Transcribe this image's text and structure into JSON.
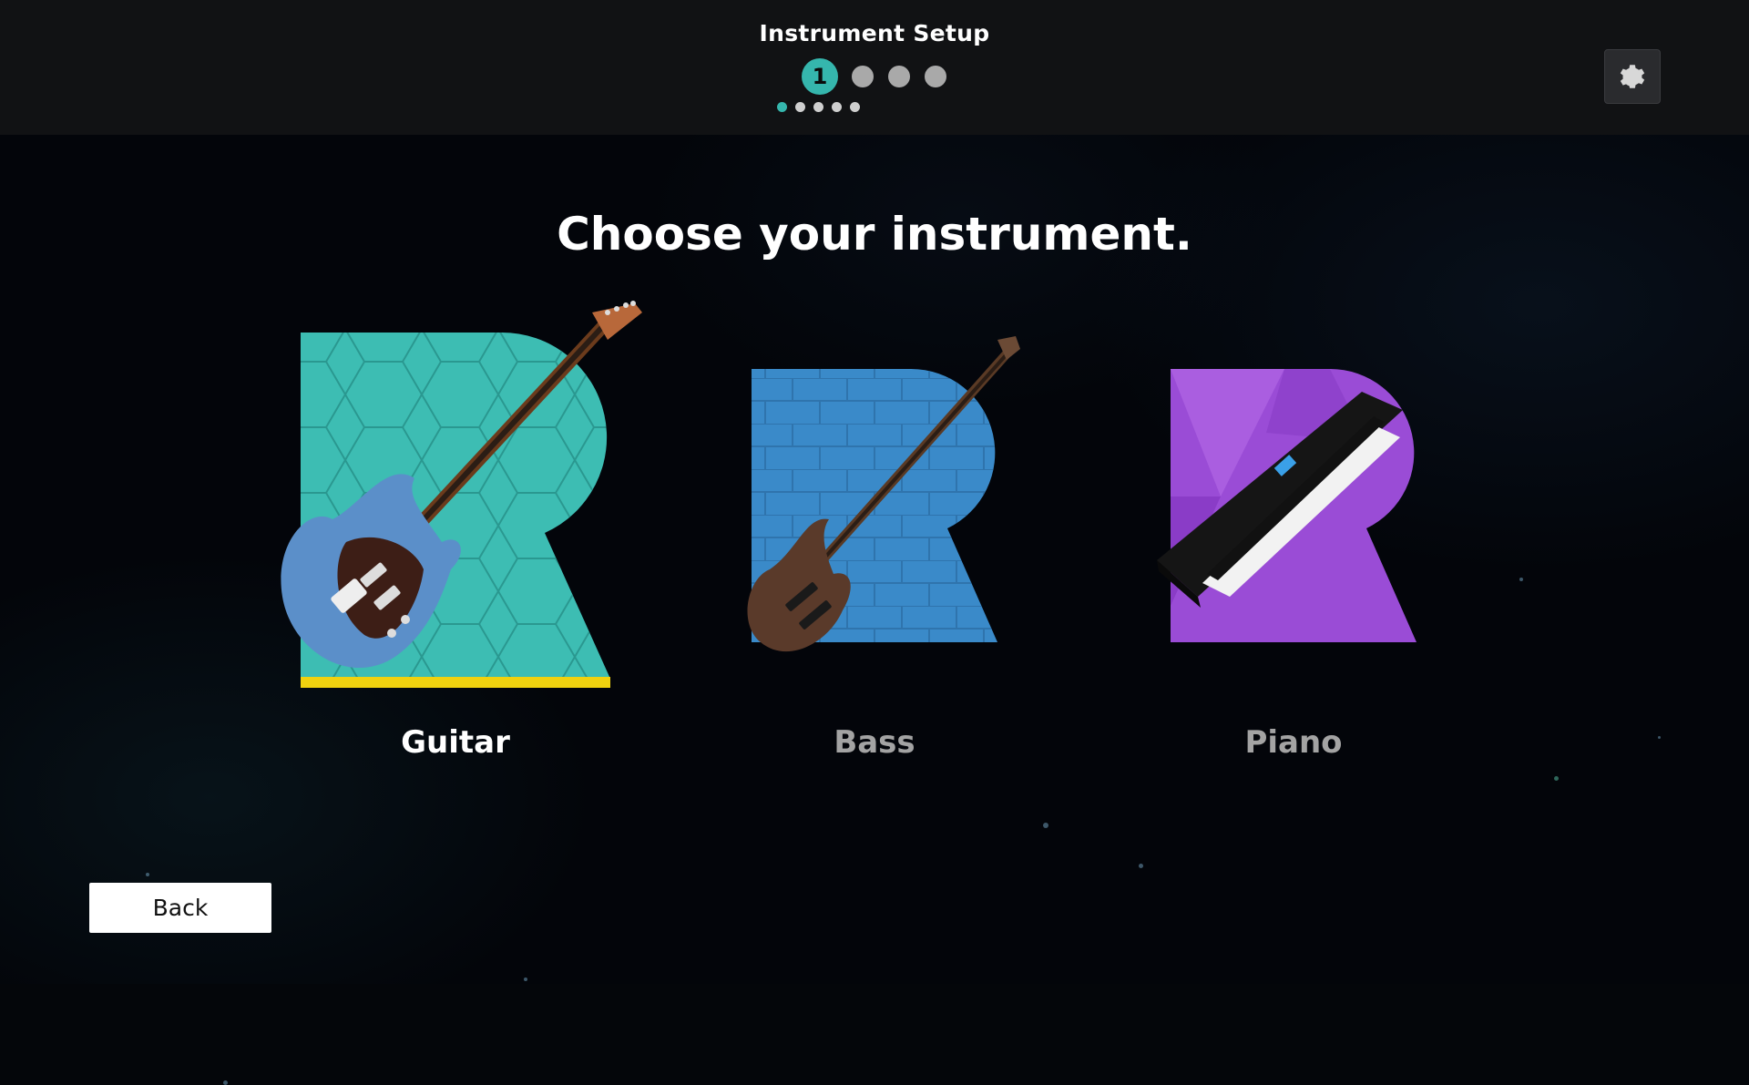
{
  "header": {
    "title": "Instrument Setup",
    "steps": [
      {
        "label": "1",
        "active": true
      },
      {
        "label": "",
        "active": false
      },
      {
        "label": "",
        "active": false
      },
      {
        "label": "",
        "active": false
      }
    ],
    "substeps": [
      {
        "active": true
      },
      {
        "active": false
      },
      {
        "active": false
      },
      {
        "active": false
      },
      {
        "active": false
      }
    ],
    "settings_icon": "gear-icon"
  },
  "main": {
    "headline": "Choose your instrument.",
    "instruments": [
      {
        "id": "guitar",
        "label": "Guitar",
        "selected": true,
        "color": "#3dbdb3",
        "label_color": "#ffffff",
        "icon": "guitar-icon"
      },
      {
        "id": "bass",
        "label": "Bass",
        "selected": false,
        "color": "#3a8ac9",
        "label_color": "#a3a3a3",
        "icon": "bass-icon"
      },
      {
        "id": "piano",
        "label": "Piano",
        "selected": false,
        "color": "#9a4cd6",
        "label_color": "#a3a3a3",
        "icon": "keyboard-icon"
      }
    ],
    "selected_underline_color": "#f0d20f"
  },
  "footer": {
    "back_label": "Back"
  }
}
